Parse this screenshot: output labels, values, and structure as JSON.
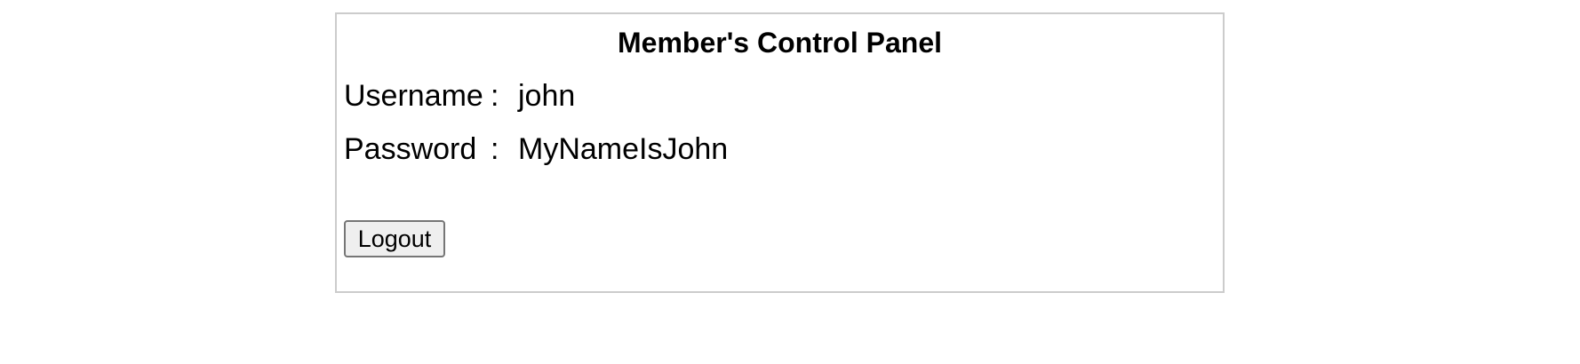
{
  "panel": {
    "title": "Member's Control Panel",
    "fields": [
      {
        "label": "Username",
        "separator": ":",
        "value": "john"
      },
      {
        "label": "Password",
        "separator": ":",
        "value": "MyNameIsJohn"
      }
    ],
    "logout_label": "Logout"
  },
  "colors": {
    "panel_border": "#cccccc",
    "button_background": "#efefef",
    "button_border": "#767676"
  }
}
